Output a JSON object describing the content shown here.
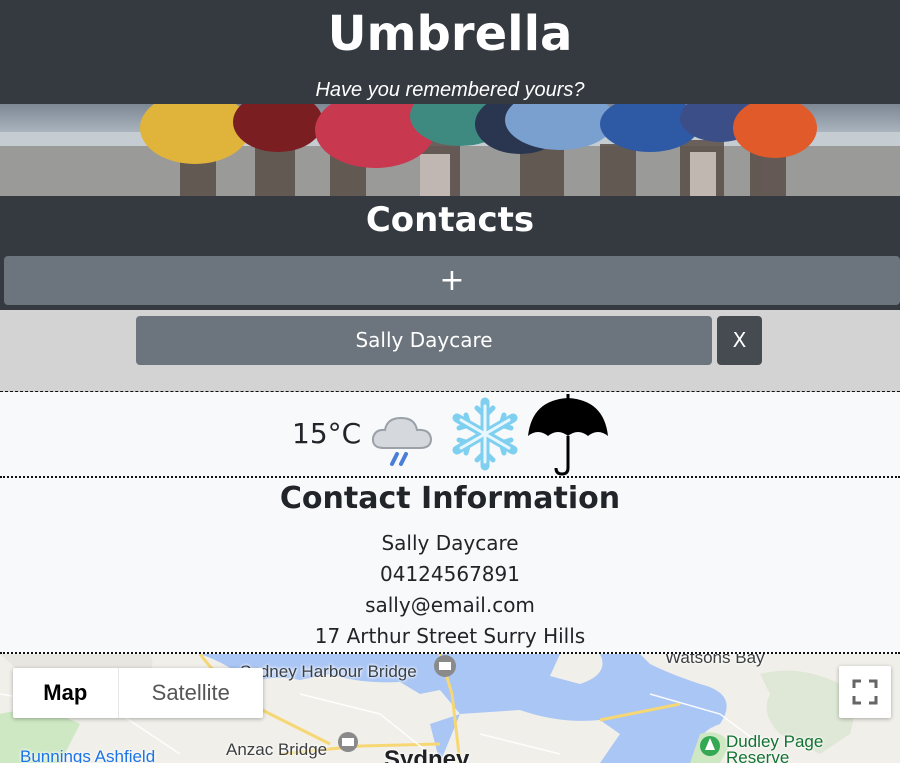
{
  "header": {
    "title": "Umbrella",
    "tagline": "Have you remembered yours?"
  },
  "contacts": {
    "title": "Contacts",
    "add_label": "+",
    "selected_contact": "Sally Daycare",
    "delete_label": "X"
  },
  "weather": {
    "temperature": "15°C",
    "icons": [
      "rain-cloud-icon",
      "snowflake-icon",
      "umbrella-icon"
    ]
  },
  "contact_info": {
    "title": "Contact Information",
    "name": "Sally Daycare",
    "phone": "04124567891",
    "email": "sally@email.com",
    "address": "17 Arthur Street Surry Hills"
  },
  "map": {
    "map_tab": "Map",
    "satellite_tab": "Satellite",
    "labels": {
      "harbour_bridge": "Sydney Harbour Bridge",
      "watsons_bay": "Watsons Bay",
      "anzac_bridge": "Anzac Bridge",
      "bunnings": "Bunnings Ashfield",
      "sydney": "Sydney",
      "dudley_page": "Dudley Page Reserve"
    }
  },
  "colors": {
    "dark_header": "#343a40",
    "button_gray": "#6c757d",
    "delete_gray": "#454b51",
    "contact_row_bg": "#d3d3d3",
    "page_bg": "#f8f9fa",
    "map_water": "#aac6f5"
  }
}
